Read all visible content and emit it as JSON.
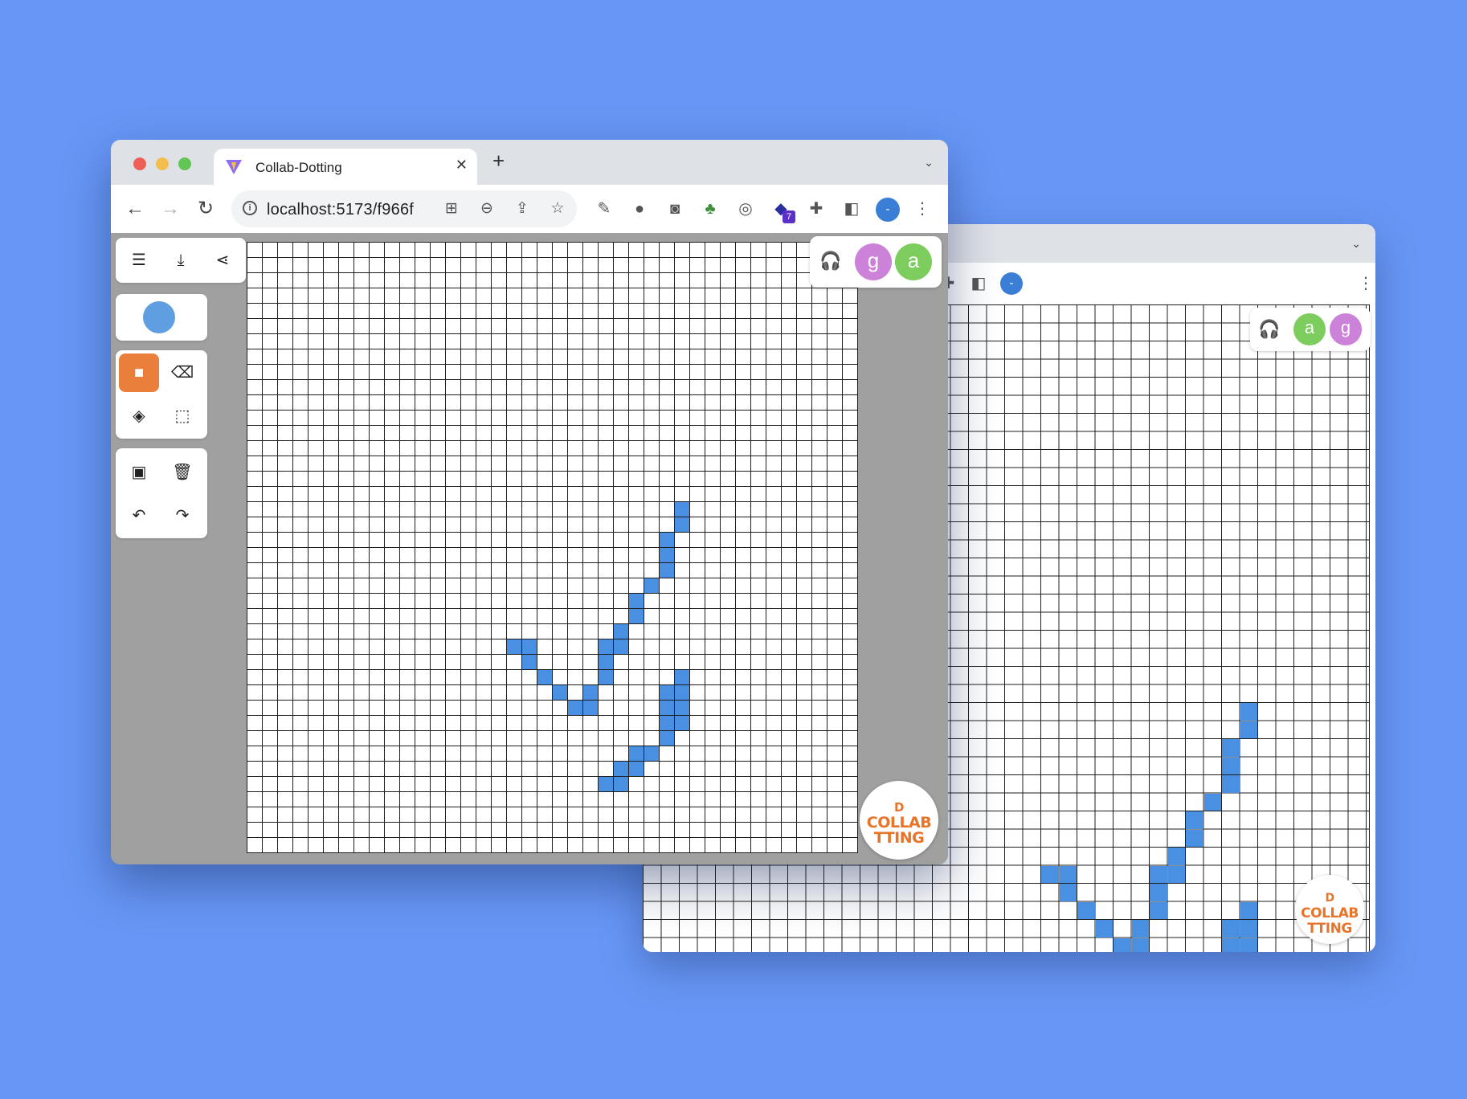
{
  "browser": {
    "tab_title": "Collab-Dotting",
    "tab_close": "✕",
    "new_tab": "+",
    "tab_menu": "⌄",
    "url": "localhost:5173/f966f",
    "profile_initial": "-",
    "extension_badge": "7"
  },
  "toolbar": {
    "menu_icon": "☰",
    "download_icon": "⤓",
    "share_icon": "⋖"
  },
  "tools": {
    "pen_label": "■",
    "eraser_label": "⌫",
    "fill_label": "◈",
    "select_label": "⬚",
    "add_image_label": "▣",
    "trash_label": "🗑",
    "undo_label": "↶",
    "redo_label": "↷",
    "active_tool": "pen",
    "selected_color": "#5e9ee1"
  },
  "presence": {
    "front_users": [
      {
        "initial": "g",
        "color": "#cb82d8"
      },
      {
        "initial": "a",
        "color": "#7ccc5e"
      }
    ],
    "back_users": [
      {
        "initial": "a",
        "color": "#7ccc5e"
      },
      {
        "initial": "g",
        "color": "#cb82d8"
      }
    ],
    "headset_icon": "🎧"
  },
  "logo": {
    "line1": "D",
    "line2": "COLLAB",
    "line3": "TTING"
  },
  "canvas": {
    "pixel_color": "#4a90e2"
  }
}
